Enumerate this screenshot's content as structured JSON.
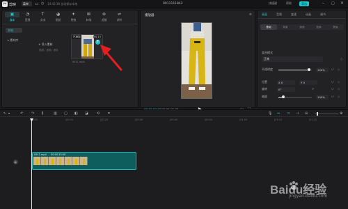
{
  "titlebar": {
    "app_name": "剪映",
    "menu_label": "菜单",
    "autosave": "14:43:38 自动保存本地",
    "project_title": "0911111842",
    "right_items": [
      "快捷键",
      "帮助"
    ],
    "export_label": "导出"
  },
  "toolbar_tabs": [
    {
      "label": "媒体",
      "icon": "media-icon"
    },
    {
      "label": "音频",
      "icon": "audio-icon"
    },
    {
      "label": "文本",
      "icon": "text-icon"
    },
    {
      "label": "贴纸",
      "icon": "sticker-icon"
    },
    {
      "label": "特效",
      "icon": "effects-icon"
    },
    {
      "label": "转场",
      "icon": "transition-icon"
    },
    {
      "label": "滤镜",
      "icon": "filter-icon"
    },
    {
      "label": "调节",
      "icon": "adjust-icon"
    }
  ],
  "media": {
    "side_items": [
      "本地",
      "素材库"
    ],
    "import_label": "导入素材",
    "import_hint": "视频、音频、图片",
    "thumb": {
      "added": "已添加",
      "duration": "00:15",
      "name": "0911.mp4"
    }
  },
  "player": {
    "title": "播放器",
    "current_time": "00:00:00:00",
    "total_time": "00:00:15:00"
  },
  "properties": {
    "tabs": [
      "画面",
      "音频",
      "变速",
      "动画",
      "调节"
    ],
    "sub_tabs": [
      "基础",
      "背景",
      "美颜",
      "抠像",
      "蒙版"
    ],
    "blend_label": "混合模式",
    "blend_value": "正常",
    "opacity_label": "不透明度",
    "opacity_value": "100%",
    "position_label": "位置",
    "position_x": "0",
    "position_y": "0",
    "rotation_label": "旋转",
    "rotation_value": "0°",
    "scale_label": "缩放",
    "scale_value": "100%"
  },
  "timeline": {
    "ticks": [
      "00:00",
      "|00:10",
      "|00:20",
      "|00:30",
      "|00:40",
      "|00:50",
      "|01:00",
      "|01:10",
      "|01:20"
    ],
    "clip_name": "0911.mp4",
    "clip_duration": "00:00:15:00"
  },
  "watermark": {
    "text": "Baidu经验",
    "sub": "jingyan.baidu.com"
  },
  "colors": {
    "accent": "#1dc4cd",
    "clip": "#0f5e5e",
    "arrow": "#e51f1f"
  }
}
